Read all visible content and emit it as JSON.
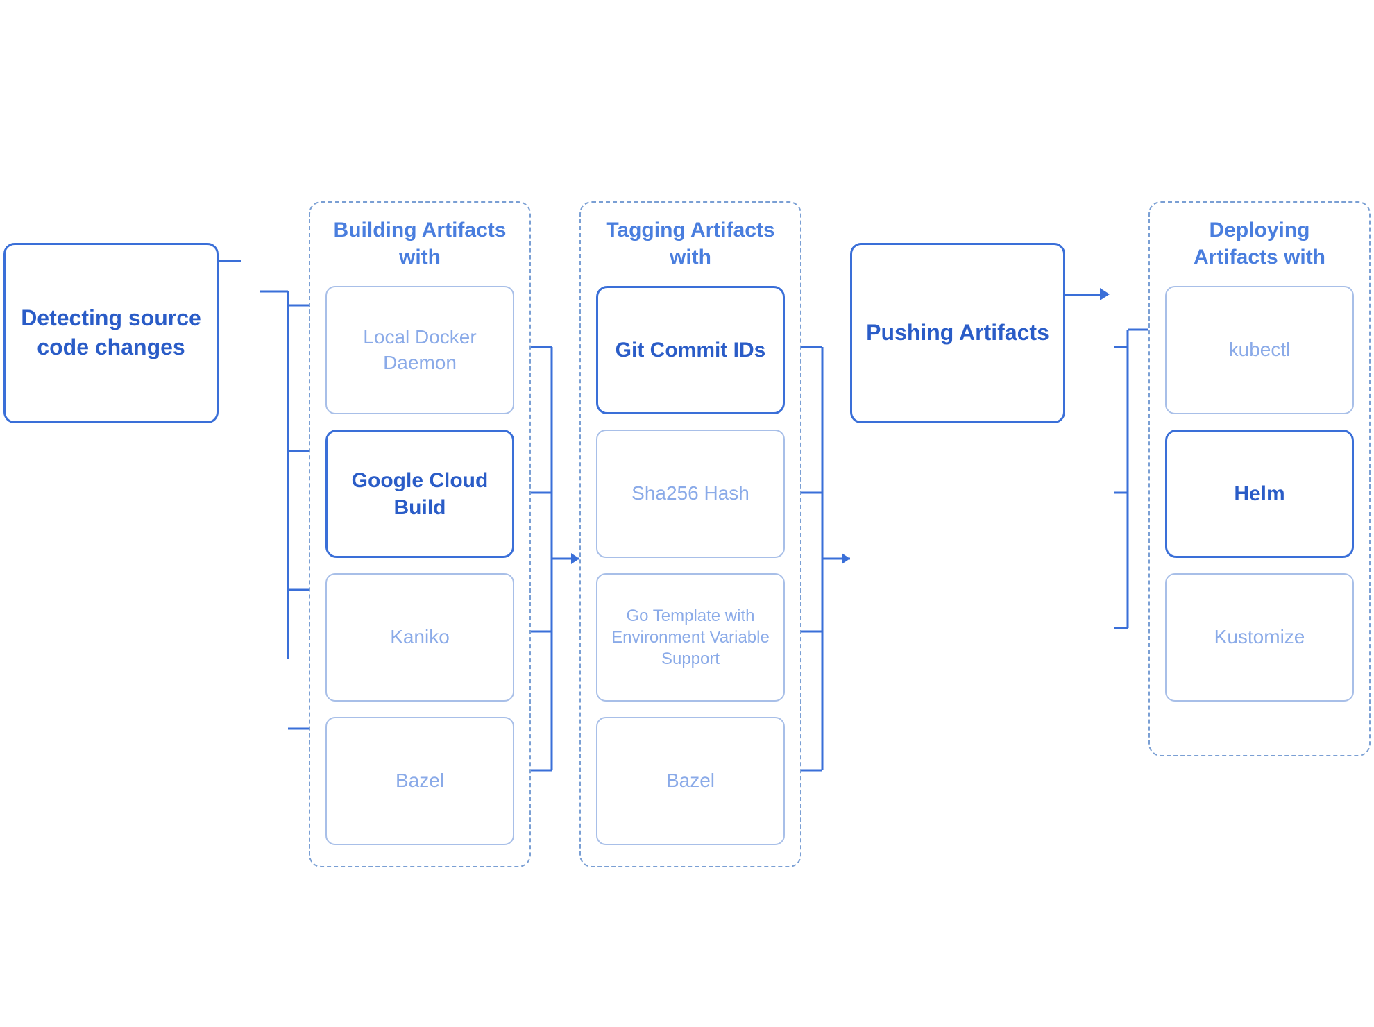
{
  "colors": {
    "solid_border": "#3a6fd8",
    "light_border": "#a8bfe8",
    "dashed_border": "#7a9fd4",
    "solid_text": "#2a5cc7",
    "light_text": "#8aaae8",
    "header_text": "#4a7ede",
    "connector": "#3a6fd8",
    "bg": "#ffffff"
  },
  "detect": {
    "label": "Detecting source code changes"
  },
  "building": {
    "title": "Building Artifacts with",
    "items": [
      {
        "label": "Local Docker Daemon",
        "style": "light"
      },
      {
        "label": "Google Cloud Build",
        "style": "solid"
      },
      {
        "label": "Kaniko",
        "style": "light"
      },
      {
        "label": "Bazel",
        "style": "light"
      }
    ]
  },
  "tagging": {
    "title": "Tagging Artifacts with",
    "items": [
      {
        "label": "Git Commit IDs",
        "style": "solid"
      },
      {
        "label": "Sha256 Hash",
        "style": "light"
      },
      {
        "label": "Go Template with Environment Variable Support",
        "style": "light"
      },
      {
        "label": "Bazel",
        "style": "light"
      }
    ]
  },
  "pushing": {
    "label": "Pushing Artifacts"
  },
  "deploying": {
    "title": "Deploying Artifacts with",
    "items": [
      {
        "label": "kubectl",
        "style": "light"
      },
      {
        "label": "Helm",
        "style": "solid"
      },
      {
        "label": "Kustomize",
        "style": "light"
      }
    ]
  }
}
